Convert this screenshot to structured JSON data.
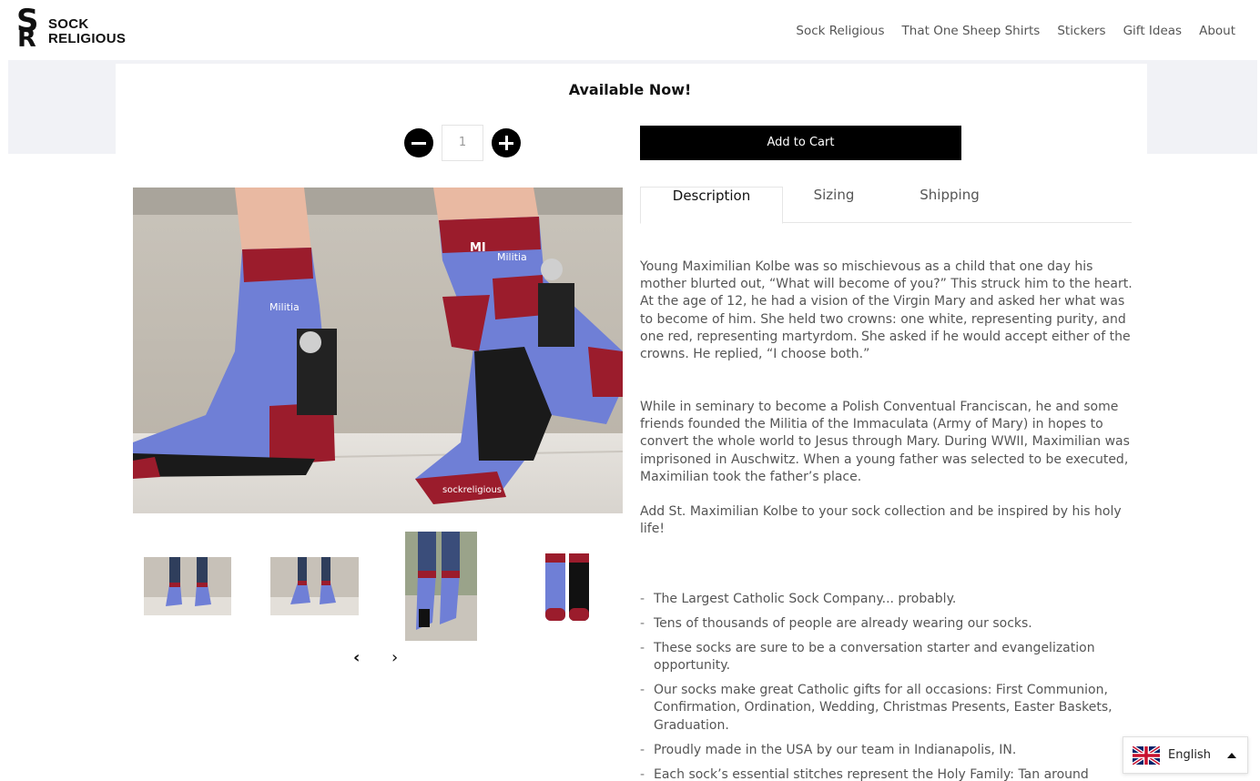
{
  "brand": {
    "line1": "SOCK",
    "line2": "RELIGIOUS",
    "logo_letters": "SR"
  },
  "nav": {
    "items": [
      {
        "label": "Sock Religious"
      },
      {
        "label": "That One Sheep Shirts"
      },
      {
        "label": "Stickers"
      },
      {
        "label": "Gift Ideas"
      },
      {
        "label": "About"
      }
    ]
  },
  "product": {
    "availability": "Available Now!",
    "quantity": "1",
    "add_to_cart_label": "Add to Cart",
    "thumbnails": [
      "thumbnail-1",
      "thumbnail-2",
      "thumbnail-3",
      "thumbnail-4"
    ]
  },
  "tabs": [
    {
      "label": "Description",
      "active": true
    },
    {
      "label": "Sizing",
      "active": false
    },
    {
      "label": "Shipping",
      "active": false
    }
  ],
  "description": {
    "paragraphs": [
      "Young Maximilian Kolbe was so mischievous as a child that one day his mother blurted out, “What will become of you?” This struck him to the heart. At the age of 12, he had a vision of the Virgin Mary and asked her what was to become of him. She held two crowns: one white, representing purity, and one red, representing martyrdom. She asked if he would accept either of the crowns. He replied, “I choose both.”",
      "While in seminary to become a Polish Conventual Franciscan, he and some friends founded the Militia of the Immaculata (Army of Mary) in hopes to convert the whole world to Jesus through Mary. During WWII, Maximilian was imprisoned in Auschwitz. When a young father was selected to be executed, Maximilian took the father’s place.",
      "Add St. Maximilian Kolbe to your sock collection and be inspired by his holy life!"
    ],
    "bullets": [
      "The Largest Catholic Sock Company... probably.",
      "Tens of thousands of people are already wearing our socks.",
      "These socks are sure to be a conversation starter and evangelization opportunity.",
      "Our socks make great Catholic gifts for all occasions: First Communion, Confirmation, Ordination, Wedding, Christmas Presents, Easter Baskets, Graduation.",
      "Proudly made in the USA by our team in Indianapolis, IN.",
      "Each sock’s essential stitches represent the Holy Family: Tan around"
    ]
  },
  "sock_print": {
    "left_text": "Militia",
    "right_text": "Militia",
    "sole_text": "sockreligious",
    "badge": "MI"
  },
  "language": {
    "label": "English",
    "flag": "uk-flag-icon"
  },
  "colors": {
    "sock_blue": "#6f7fd6",
    "sock_red": "#9b1c2c",
    "accent_black": "#000000",
    "band_grey": "#f1f2f6"
  }
}
